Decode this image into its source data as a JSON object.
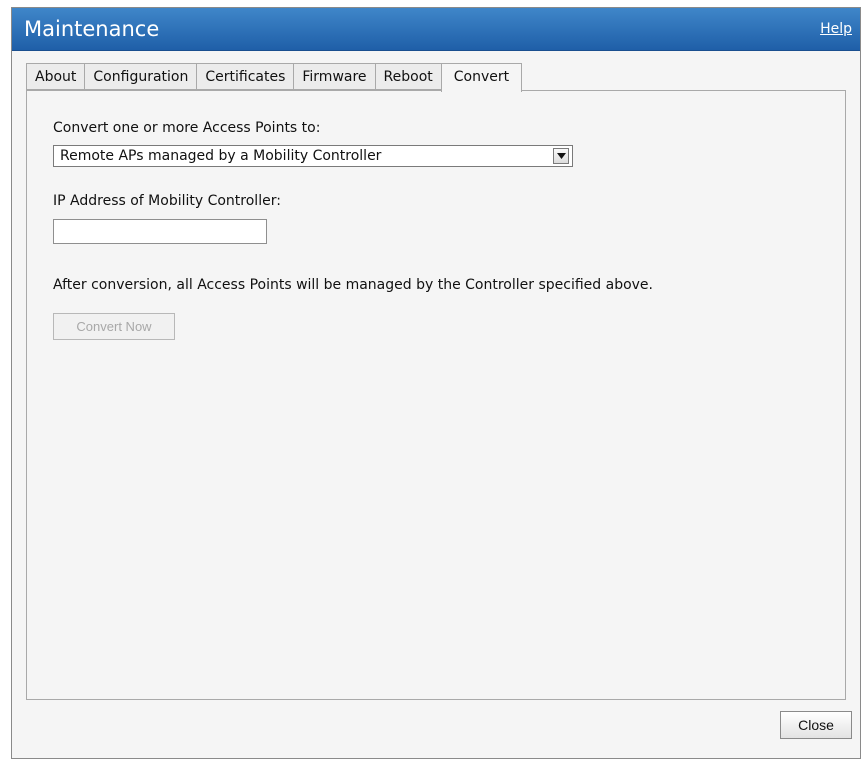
{
  "dialog": {
    "title": "Maintenance",
    "help_link": "Help"
  },
  "tabs": [
    {
      "label": "About",
      "active": false
    },
    {
      "label": "Configuration",
      "active": false
    },
    {
      "label": "Certificates",
      "active": false
    },
    {
      "label": "Firmware",
      "active": false
    },
    {
      "label": "Reboot",
      "active": false
    },
    {
      "label": "Convert",
      "active": true
    }
  ],
  "convert": {
    "convert_label": "Convert one or more Access Points to:",
    "convert_select_value": "Remote APs managed by a Mobility Controller",
    "ip_label": "IP Address of Mobility Controller:",
    "ip_value": "",
    "note": "After conversion, all Access Points will be managed by the Controller specified above.",
    "convert_button": "Convert Now"
  },
  "footer": {
    "close_button": "Close"
  },
  "colors": {
    "titlebar": "#2a6fb8",
    "panel_bg": "#f5f5f5",
    "disabled_text": "#a8a8a8"
  }
}
